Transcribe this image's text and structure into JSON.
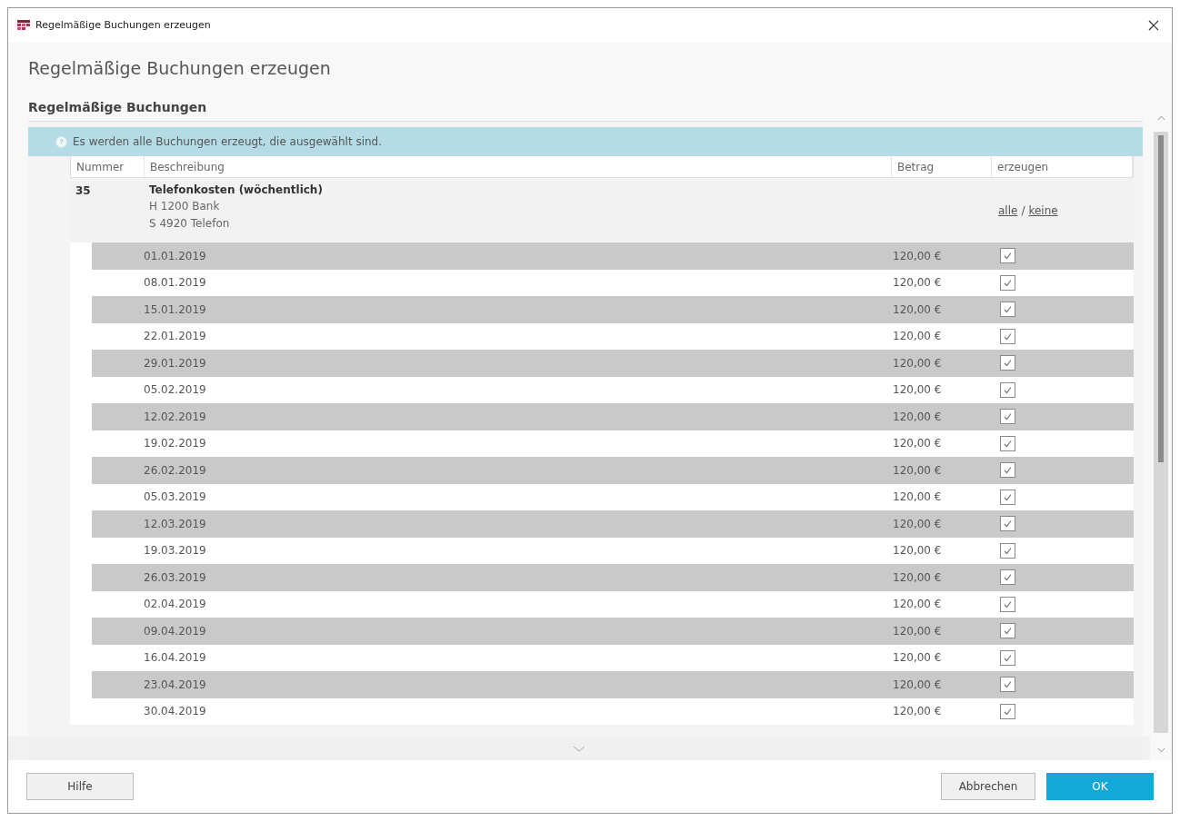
{
  "window": {
    "title": "Regelmäßige Buchungen erzeugen"
  },
  "heading": "Regelmäßige Buchungen erzeugen",
  "section": "Regelmäßige Buchungen",
  "info": "Es werden alle Buchungen erzeugt, die ausgewählt sind.",
  "table": {
    "columns": [
      "Nummer",
      "Beschreibung",
      "Betrag",
      "erzeugen"
    ],
    "group": {
      "number": "35",
      "title": "Telefonkosten (wöchentlich)",
      "lines": [
        "H 1200 Bank",
        "S 4920 Telefon"
      ],
      "all": "alle",
      "separator": "/",
      "none": "keine"
    },
    "rows": [
      {
        "kind": "row",
        "date": "01.01.2019",
        "amount": "120,00 €",
        "checked": true
      },
      {
        "kind": "row",
        "date": "08.01.2019",
        "amount": "120,00 €",
        "checked": true
      },
      {
        "kind": "row",
        "date": "15.01.2019",
        "amount": "120,00 €",
        "checked": true
      },
      {
        "kind": "row",
        "date": "22.01.2019",
        "amount": "120,00 €",
        "checked": true
      },
      {
        "kind": "row",
        "date": "29.01.2019",
        "amount": "120,00 €",
        "checked": true
      },
      {
        "kind": "row",
        "date": "05.02.2019",
        "amount": "120,00 €",
        "checked": true
      },
      {
        "kind": "row",
        "date": "12.02.2019",
        "amount": "120,00 €",
        "checked": true
      },
      {
        "kind": "row",
        "date": "19.02.2019",
        "amount": "120,00 €",
        "checked": true
      },
      {
        "kind": "row",
        "date": "26.02.2019",
        "amount": "120,00 €",
        "checked": true
      },
      {
        "kind": "row",
        "date": "05.03.2019",
        "amount": "120,00 €",
        "checked": true
      },
      {
        "kind": "row",
        "date": "12.03.2019",
        "amount": "120,00 €",
        "checked": true
      },
      {
        "kind": "row",
        "date": "19.03.2019",
        "amount": "120,00 €",
        "checked": true
      },
      {
        "kind": "row",
        "date": "26.03.2019",
        "amount": "120,00 €",
        "checked": true
      },
      {
        "kind": "row",
        "date": "02.04.2019",
        "amount": "120,00 €",
        "checked": true
      },
      {
        "kind": "row",
        "date": "09.04.2019",
        "amount": "120,00 €",
        "checked": true
      },
      {
        "kind": "row",
        "date": "16.04.2019",
        "amount": "120,00 €",
        "checked": true
      },
      {
        "kind": "row",
        "date": "23.04.2019",
        "amount": "120,00 €",
        "checked": true
      },
      {
        "kind": "row",
        "date": "30.04.2019",
        "amount": "120,00 €",
        "checked": true
      }
    ]
  },
  "buttons": {
    "help": "Hilfe",
    "cancel": "Abbrechen",
    "ok": "OK"
  }
}
